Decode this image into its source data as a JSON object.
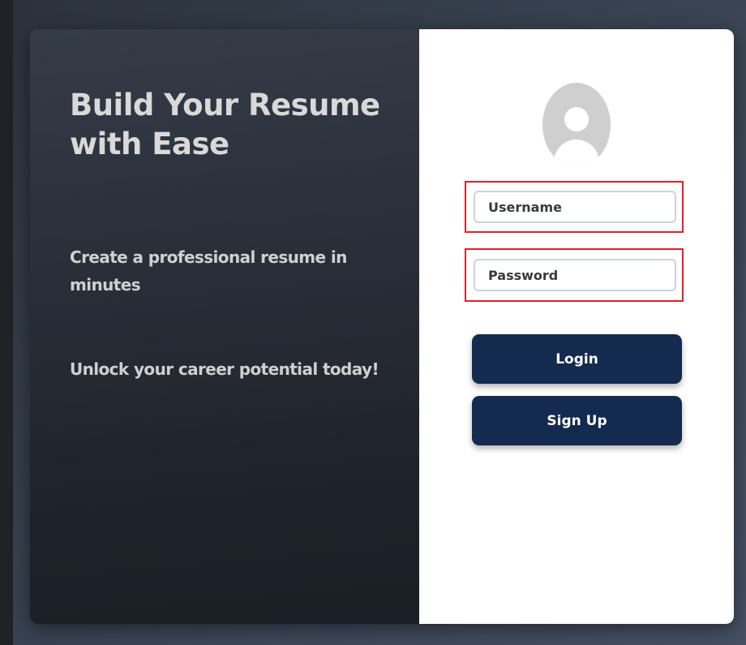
{
  "hero": {
    "headline": "Build Your Resume with Ease",
    "tagline_1": "Create a professional resume in minutes",
    "tagline_2": "Unlock your career potential today!"
  },
  "form": {
    "avatar_icon": "user-avatar-icon",
    "username_placeholder": "Username",
    "password_placeholder": "Password",
    "login_label": "Login",
    "signup_label": "Sign Up"
  },
  "colors": {
    "button_bg": "#142a4f",
    "highlight_border": "#e0202a",
    "panel_dark": "#20252d",
    "headline_text": "#d9d9d9"
  }
}
